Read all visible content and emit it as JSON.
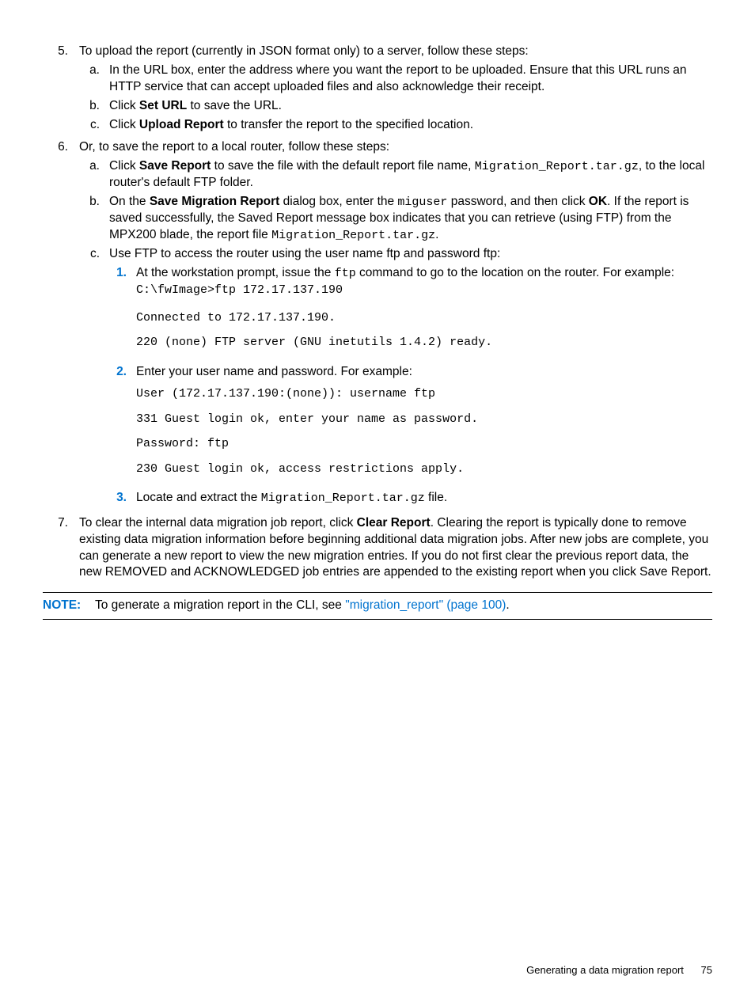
{
  "steps": {
    "s5": {
      "num": "5.",
      "text": "To upload the report (currently in JSON format only) to a server, follow these steps:",
      "a": {
        "num": "a.",
        "text": "In the URL box, enter the address where you want the report to be uploaded. Ensure that this URL runs an HTTP service that can accept uploaded files and also acknowledge their receipt."
      },
      "b": {
        "num": "b.",
        "pre": "Click ",
        "bold": "Set URL",
        "post": " to save the URL."
      },
      "c": {
        "num": "c.",
        "pre": "Click ",
        "bold": "Upload Report",
        "post": " to transfer the report to the specified location."
      }
    },
    "s6": {
      "num": "6.",
      "text": "Or, to save the report to a local router, follow these steps:",
      "a": {
        "num": "a.",
        "l1pre": "Click ",
        "l1bold": "Save Report",
        "l1post": " to save the file with the default report file name, ",
        "l2mono": "Migration_Report.tar.gz",
        "l2post": ", to the local router's default FTP folder."
      },
      "b": {
        "num": "b.",
        "t1": "On the ",
        "b1": "Save Migration Report",
        "t2": " dialog box, enter the ",
        "m1": "miguser",
        "t3": " password, and then click ",
        "b2": "OK",
        "t4": ". If the report is saved successfully, the Saved Report message box indicates that you can retrieve (using FTP) from the MPX200 blade, the report file ",
        "m2": "Migration_Report.tar.gz",
        "t5": "."
      },
      "c": {
        "num": "c.",
        "text": "Use FTP to access the router using the user name ftp and password ftp:",
        "i1": {
          "num": "1.",
          "t1": "At the workstation prompt, issue the ",
          "m1": "ftp",
          "t2": " command to go to the location on the router. For example: ",
          "m2": "C:\\fwImage>ftp 172.17.137.190",
          "pre": "Connected to 172.17.137.190.\n220 (none) FTP server (GNU inetutils 1.4.2) ready."
        },
        "i2": {
          "num": "2.",
          "t1": "Enter your user name and password. For example:",
          "pre": "User (172.17.137.190:(none)): username ftp\n331 Guest login ok, enter your name as password.\nPassword: ftp\n230 Guest login ok, access restrictions apply."
        },
        "i3": {
          "num": "3.",
          "t1": "Locate and extract the ",
          "m1": "Migration_Report.tar.gz",
          "t2": " file."
        }
      }
    },
    "s7": {
      "num": "7.",
      "t1": "To clear the internal data migration job report, click ",
      "b1": "Clear Report",
      "t2": ". Clearing the report is typically done to remove existing data migration information before beginning additional data migration jobs. After new jobs are complete, you can generate a new report to view the new migration entries. If you do not first clear the previous report data, the new REMOVED and ACKNOWLEDGED job entries are appended to the existing report when you click Save Report."
    }
  },
  "note": {
    "label": "NOTE:",
    "t1": "To generate a migration report in the CLI, see ",
    "link": "\"migration_report\" (page 100)",
    "t2": "."
  },
  "footer": {
    "title": "Generating a data migration report",
    "page": "75"
  }
}
